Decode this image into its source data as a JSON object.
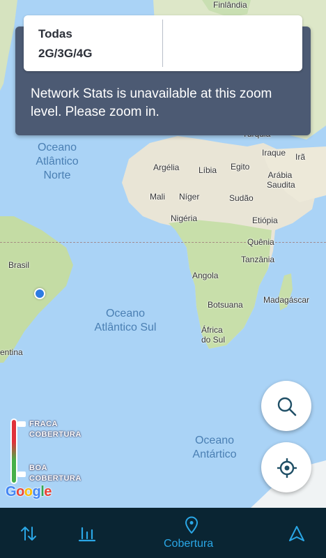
{
  "filter": {
    "title": "Todas",
    "subtitle": "2G/3G/4G"
  },
  "info": {
    "message": "Network Stats is unavailable at this zoom level. Please zoom in."
  },
  "map": {
    "labels": {
      "finlandia": "Finlândia",
      "turquia": "Turquia",
      "iraque": "Iraque",
      "ira": "Irã",
      "argelia": "Argélia",
      "libia": "Líbia",
      "egito": "Egito",
      "arabia": "Arábia Saudita",
      "mali": "Mali",
      "niger": "Níger",
      "sudao": "Sudão",
      "nigeria": "Nigéria",
      "etiopia": "Etiópia",
      "quenia": "Quênia",
      "tanzania": "Tanzânia",
      "brasil": "Brasil",
      "angola": "Angola",
      "madagascar": "Madagáscar",
      "botsuana": "Botsuana",
      "africa_sul": "África do Sul",
      "argentina": "entina"
    },
    "oceans": {
      "atlantico_norte": "Oceano Atlântico Norte",
      "atlantico_sul": "Oceano Atlântico Sul",
      "antartico": "Oceano Antártico"
    }
  },
  "legend": {
    "weak": "FRACA COBERTURA",
    "good": "BOA COBERTURA"
  },
  "attribution": "Google",
  "nav": {
    "coverage_label": "Cobertura"
  },
  "colors": {
    "accent": "#2aa7e6",
    "nav_bg": "#0a2533",
    "card_bg": "#4c5a73",
    "weak": "#e0313b",
    "good": "#45b04a"
  },
  "icons": {
    "search": "search-icon",
    "locate": "crosshair-icon",
    "sort": "arrows-updown-icon",
    "stats": "bar-chart-icon",
    "coverage": "map-pin-icon",
    "speed": "navigation-arrow-icon"
  }
}
